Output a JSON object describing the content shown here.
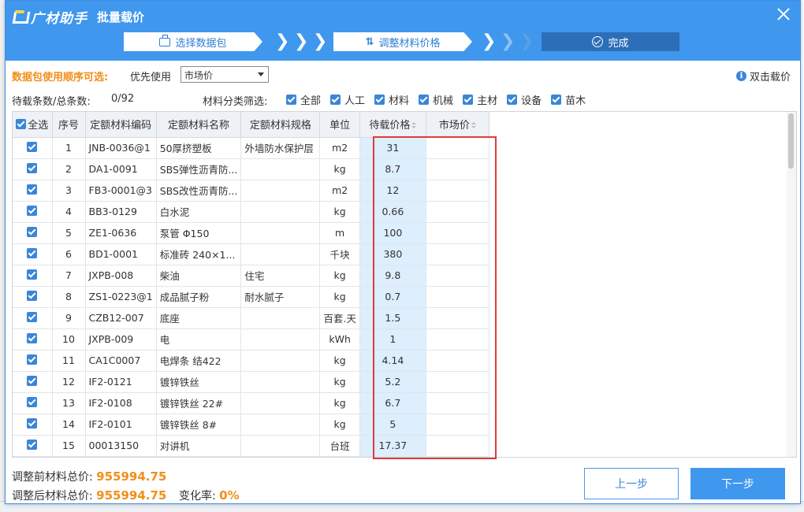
{
  "titlebar": {
    "app_name": "广材助手",
    "title": "批量载价"
  },
  "steps": [
    {
      "label": "选择数据包",
      "icon": "briefcase-icon",
      "state": "done"
    },
    {
      "label": "调整材料价格",
      "icon": "sliders-icon",
      "state": "current"
    },
    {
      "label": "完成",
      "icon": "check-circle-icon",
      "state": "pending"
    }
  ],
  "options": {
    "order_label": "数据包使用顺序可选:",
    "prefer_label": "优先使用",
    "prefer_value": "市场价",
    "double_click_label": "双击载价"
  },
  "filter": {
    "count_label": "待载条数/总条数:",
    "count_value": "0/92",
    "category_label": "材料分类筛选:",
    "categories": [
      "全部",
      "人工",
      "材料",
      "机械",
      "主材",
      "设备",
      "苗木"
    ]
  },
  "table": {
    "headers": {
      "select_all": "全选",
      "no": "序号",
      "code": "定额材料编码",
      "name": "定额材料名称",
      "spec": "定额材料规格",
      "unit": "单位",
      "pending_price": "待载价格",
      "market_price": "市场价"
    },
    "rows": [
      {
        "no": "1",
        "code": "JNB-0036@1",
        "name": "50厚挤塑板",
        "spec": "外墙防水保护层",
        "unit": "m2",
        "price": "31",
        "market": ""
      },
      {
        "no": "2",
        "code": "DA1-0091",
        "name": "SBS弹性沥青防...",
        "spec": "",
        "unit": "kg",
        "price": "8.7",
        "market": ""
      },
      {
        "no": "3",
        "code": "FB3-0001@3",
        "name": "SBS改性沥青防...",
        "spec": "",
        "unit": "m2",
        "price": "12",
        "market": ""
      },
      {
        "no": "4",
        "code": "BB3-0129",
        "name": "白水泥",
        "spec": "",
        "unit": "kg",
        "price": "0.66",
        "market": ""
      },
      {
        "no": "5",
        "code": "ZE1-0636",
        "name": "泵管 Φ150",
        "spec": "",
        "unit": "m",
        "price": "100",
        "market": ""
      },
      {
        "no": "6",
        "code": "BD1-0001",
        "name": "标准砖 240×1...",
        "spec": "",
        "unit": "千块",
        "price": "380",
        "market": ""
      },
      {
        "no": "7",
        "code": "JXPB-008",
        "name": "柴油",
        "spec": "住宅",
        "unit": "kg",
        "price": "9.8",
        "market": ""
      },
      {
        "no": "8",
        "code": "ZS1-0223@1",
        "name": "成品腻子粉",
        "spec": "耐水腻子",
        "unit": "kg",
        "price": "0.7",
        "market": ""
      },
      {
        "no": "9",
        "code": "CZB12-007",
        "name": "底座",
        "spec": "",
        "unit": "百套.天",
        "price": "1.5",
        "market": ""
      },
      {
        "no": "10",
        "code": "JXPB-009",
        "name": "电",
        "spec": "",
        "unit": "kWh",
        "price": "1",
        "market": ""
      },
      {
        "no": "11",
        "code": "CA1C0007",
        "name": "电焊条 结422",
        "spec": "",
        "unit": "kg",
        "price": "4.14",
        "market": ""
      },
      {
        "no": "12",
        "code": "IF2-0121",
        "name": "镀锌铁丝",
        "spec": "",
        "unit": "kg",
        "price": "5.2",
        "market": ""
      },
      {
        "no": "13",
        "code": "IF2-0108",
        "name": "镀锌铁丝 22#",
        "spec": "",
        "unit": "kg",
        "price": "6.7",
        "market": ""
      },
      {
        "no": "14",
        "code": "IF2-0101",
        "name": "镀锌铁丝 8#",
        "spec": "",
        "unit": "kg",
        "price": "5",
        "market": ""
      },
      {
        "no": "15",
        "code": "00013150",
        "name": "对讲机",
        "spec": "",
        "unit": "台班",
        "price": "17.37",
        "market": ""
      }
    ]
  },
  "footer": {
    "before_label": "调整前材料总价:",
    "before_value": "955994.75",
    "after_label": "调整后材料总价:",
    "after_value": "955994.75",
    "rate_label": "变化率:",
    "rate_value": "0%",
    "prev_button": "上一步",
    "next_button": "下一步"
  },
  "colors": {
    "titlebar": "#3f97ee",
    "accent_orange": "#f08f1a",
    "highlight_box": "#e03a3a",
    "price_column_bg": "#ddeefd"
  }
}
